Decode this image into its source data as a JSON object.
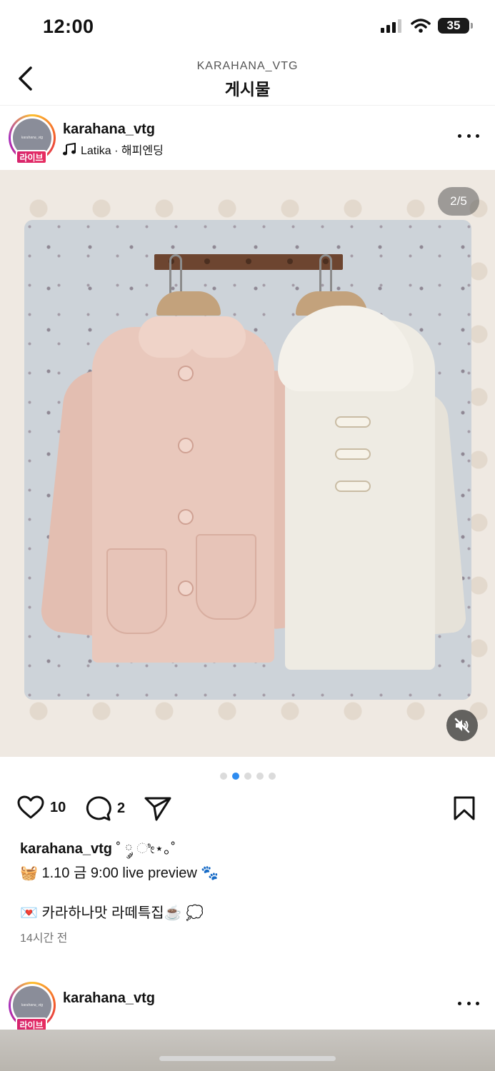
{
  "status_bar": {
    "time": "12:00",
    "battery": "35"
  },
  "nav": {
    "subtitle": "KARAHANA_VTG",
    "title": "게시물"
  },
  "post": {
    "username": "karahana_vtg",
    "avatar_text": "karahana_vtg",
    "live_label": "라이브",
    "music": "Latika · 해피엔딩",
    "counter": "2/5",
    "slide_count": 5,
    "active_slide": 2,
    "likes": "10",
    "comments": "2",
    "caption_user": "karahana_vtg",
    "caption_line1_tail": " ˚ ༘ ೀ⋆｡˚",
    "caption_line2": "🧺 1.10 금 9:00 live preview 🐾",
    "caption_line3": "💌 카라하나맛 라떼특집☕️ 💭",
    "time_ago": "14시간 전"
  },
  "next_post": {
    "username": "karahana_vtg",
    "avatar_text": "karahana_vtg",
    "live_label": "라이브"
  },
  "colors": {
    "accent_blue": "#2e8cf0",
    "live_pink": "#d6246e"
  }
}
